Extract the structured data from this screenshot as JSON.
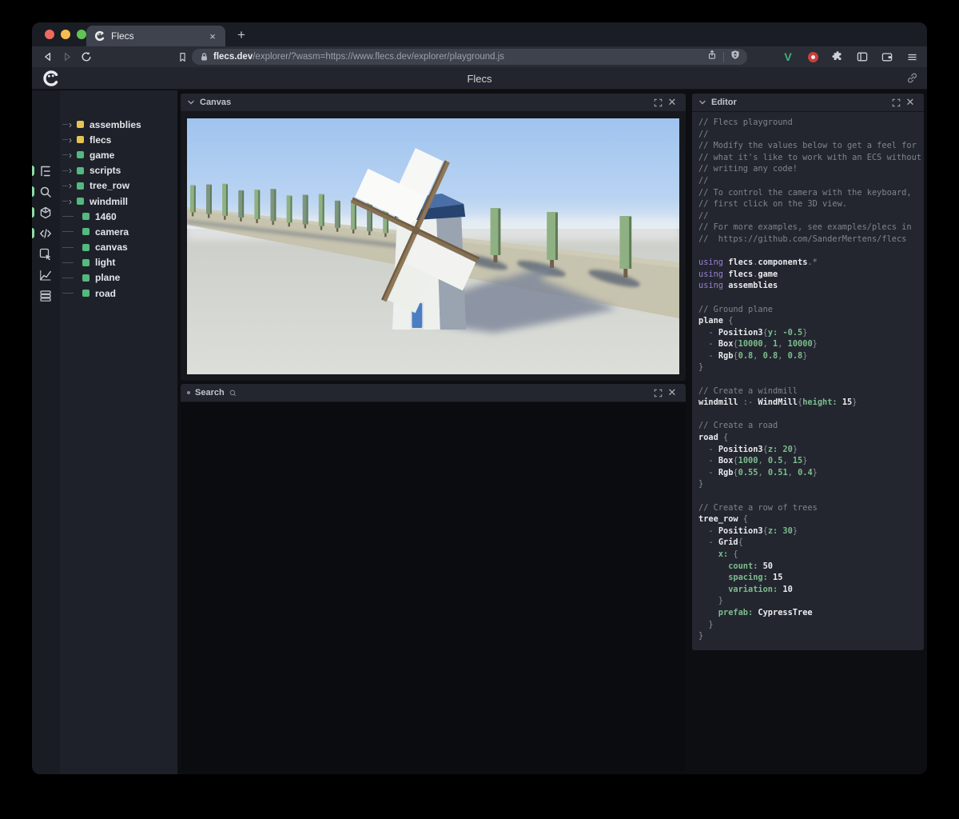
{
  "browser": {
    "tab": {
      "title": "Flecs",
      "close_label": "×"
    },
    "new_tab_label": "+",
    "url": {
      "domain": "flecs.dev",
      "path": "/explorer/?wasm=https://www.flecs.dev/explorer/playground.js"
    }
  },
  "app_header": {
    "title": "Flecs"
  },
  "activity_bar": {
    "items": [
      {
        "name": "entity-tree",
        "active": true
      },
      {
        "name": "search",
        "active": true
      },
      {
        "name": "entities-cube",
        "active": true
      },
      {
        "name": "code",
        "active": true
      },
      {
        "name": "inspector",
        "active": false
      },
      {
        "name": "stats-chart",
        "active": false
      },
      {
        "name": "queries-list",
        "active": false
      }
    ]
  },
  "entity_tree": {
    "items": [
      {
        "label": "assemblies",
        "color": "#e7c352",
        "expandable": true
      },
      {
        "label": "flecs",
        "color": "#e7c352",
        "expandable": true
      },
      {
        "label": "game",
        "color": "#54b87f",
        "expandable": true
      },
      {
        "label": "scripts",
        "color": "#54b87f",
        "expandable": true
      },
      {
        "label": "tree_row",
        "color": "#54b87f",
        "expandable": true
      },
      {
        "label": "windmill",
        "color": "#54b87f",
        "expandable": true
      },
      {
        "label": "1460",
        "color": "#54b87f",
        "expandable": false
      },
      {
        "label": "camera",
        "color": "#54b87f",
        "expandable": false
      },
      {
        "label": "canvas",
        "color": "#54b87f",
        "expandable": false
      },
      {
        "label": "light",
        "color": "#54b87f",
        "expandable": false
      },
      {
        "label": "plane",
        "color": "#54b87f",
        "expandable": false
      },
      {
        "label": "road",
        "color": "#54b87f",
        "expandable": false
      }
    ]
  },
  "panels": {
    "canvas": {
      "title": "Canvas"
    },
    "search": {
      "title": "Search"
    },
    "editor": {
      "title": "Editor"
    }
  },
  "scene": {
    "sky_top": "#9fc4ef",
    "sky_mid": "#b9d3f2",
    "sky_horizon": "#e2eaf1",
    "ground": "#d2d4d0",
    "ground_light": "#dcded9",
    "road": "#c6c3ae",
    "tree_green": "#8fb083",
    "tree_green_dark": "#5e7b55",
    "trunk_brown": "#6f604a",
    "sail_white": "#f7f8f6",
    "beam_brown": "#8d7758",
    "tower_light": "#eef0ed",
    "tower_shade": "#9aa3b0",
    "cap_blue": "#33558a",
    "cap_blue_top": "#4a6ea6",
    "door_blue": "#4a7dc2",
    "shadow": "#7b8599"
  },
  "editor_code": {
    "lines": [
      [
        [
          "c",
          "// Flecs playground"
        ]
      ],
      [
        [
          "c",
          "//"
        ]
      ],
      [
        [
          "c",
          "// Modify the values below to get a feel for"
        ]
      ],
      [
        [
          "c",
          "// what it's like to work with an ECS without"
        ]
      ],
      [
        [
          "c",
          "// writing any code!"
        ]
      ],
      [
        [
          "c",
          "//"
        ]
      ],
      [
        [
          "c",
          "// To control the camera with the keyboard,"
        ]
      ],
      [
        [
          "c",
          "// first click on the 3D view."
        ]
      ],
      [
        [
          "c",
          "//"
        ]
      ],
      [
        [
          "c",
          "// For more examples, see examples/plecs in"
        ]
      ],
      [
        [
          "c",
          "//  https://github.com/SanderMertens/flecs"
        ]
      ],
      [],
      [
        [
          "k",
          "using "
        ],
        [
          "i",
          "flecs"
        ],
        [
          "p",
          "."
        ],
        [
          "i",
          "components"
        ],
        [
          "p",
          ".*"
        ]
      ],
      [
        [
          "k",
          "using "
        ],
        [
          "i",
          "flecs"
        ],
        [
          "p",
          "."
        ],
        [
          "i",
          "game"
        ]
      ],
      [
        [
          "k",
          "using "
        ],
        [
          "i",
          "assemblies"
        ]
      ],
      [],
      [
        [
          "c",
          "// Ground plane"
        ]
      ],
      [
        [
          "i",
          "plane "
        ],
        [
          "p",
          "{"
        ]
      ],
      [
        [
          "p",
          "  - "
        ],
        [
          "i",
          "Position3"
        ],
        [
          "p",
          "{"
        ],
        [
          "g",
          "y: -0.5"
        ],
        [
          "p",
          "}"
        ]
      ],
      [
        [
          "p",
          "  - "
        ],
        [
          "i",
          "Box"
        ],
        [
          "p",
          "{"
        ],
        [
          "g",
          "10000"
        ],
        [
          "p",
          ", "
        ],
        [
          "g",
          "1"
        ],
        [
          "p",
          ", "
        ],
        [
          "g",
          "10000"
        ],
        [
          "p",
          "}"
        ]
      ],
      [
        [
          "p",
          "  - "
        ],
        [
          "i",
          "Rgb"
        ],
        [
          "p",
          "{"
        ],
        [
          "g",
          "0.8"
        ],
        [
          "p",
          ", "
        ],
        [
          "g",
          "0.8"
        ],
        [
          "p",
          ", "
        ],
        [
          "g",
          "0.8"
        ],
        [
          "p",
          "}"
        ]
      ],
      [
        [
          "p",
          "}"
        ]
      ],
      [],
      [
        [
          "c",
          "// Create a windmill"
        ]
      ],
      [
        [
          "i",
          "windmill "
        ],
        [
          "p",
          ":- "
        ],
        [
          "i",
          "WindMill"
        ],
        [
          "p",
          "{"
        ],
        [
          "g",
          "height: "
        ],
        [
          "w",
          "15"
        ],
        [
          "p",
          "}"
        ]
      ],
      [],
      [
        [
          "c",
          "// Create a road"
        ]
      ],
      [
        [
          "i",
          "road "
        ],
        [
          "p",
          "{"
        ]
      ],
      [
        [
          "p",
          "  - "
        ],
        [
          "i",
          "Position3"
        ],
        [
          "p",
          "{"
        ],
        [
          "g",
          "z: 20"
        ],
        [
          "p",
          "}"
        ]
      ],
      [
        [
          "p",
          "  - "
        ],
        [
          "i",
          "Box"
        ],
        [
          "p",
          "{"
        ],
        [
          "g",
          "1000"
        ],
        [
          "p",
          ", "
        ],
        [
          "g",
          "0.5"
        ],
        [
          "p",
          ", "
        ],
        [
          "g",
          "15"
        ],
        [
          "p",
          "}"
        ]
      ],
      [
        [
          "p",
          "  - "
        ],
        [
          "i",
          "Rgb"
        ],
        [
          "p",
          "{"
        ],
        [
          "g",
          "0.55"
        ],
        [
          "p",
          ", "
        ],
        [
          "g",
          "0.51"
        ],
        [
          "p",
          ", "
        ],
        [
          "g",
          "0.4"
        ],
        [
          "p",
          "}"
        ]
      ],
      [
        [
          "p",
          "}"
        ]
      ],
      [],
      [
        [
          "c",
          "// Create a row of trees"
        ]
      ],
      [
        [
          "i",
          "tree_row "
        ],
        [
          "p",
          "{"
        ]
      ],
      [
        [
          "p",
          "  - "
        ],
        [
          "i",
          "Position3"
        ],
        [
          "p",
          "{"
        ],
        [
          "g",
          "z: 30"
        ],
        [
          "p",
          "}"
        ]
      ],
      [
        [
          "p",
          "  - "
        ],
        [
          "i",
          "Grid"
        ],
        [
          "p",
          "{"
        ]
      ],
      [
        [
          "g",
          "    x: "
        ],
        [
          "p",
          "{"
        ]
      ],
      [
        [
          "g",
          "      count: "
        ],
        [
          "w",
          "50"
        ]
      ],
      [
        [
          "g",
          "      spacing: "
        ],
        [
          "w",
          "15"
        ]
      ],
      [
        [
          "g",
          "      variation: "
        ],
        [
          "w",
          "10"
        ]
      ],
      [
        [
          "p",
          "    }"
        ]
      ],
      [
        [
          "g",
          "    prefab: "
        ],
        [
          "w",
          "CypressTree"
        ]
      ],
      [
        [
          "p",
          "  }"
        ]
      ],
      [
        [
          "p",
          "}"
        ]
      ]
    ]
  }
}
